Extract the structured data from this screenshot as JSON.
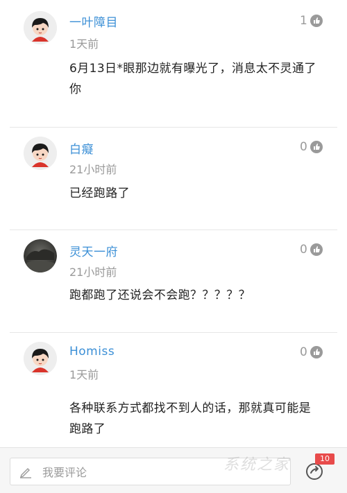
{
  "comments": [
    {
      "username": "一叶障目",
      "time": "1天前",
      "likes": "1",
      "content": "6月13日*眼那边就有曝光了，消息太不灵通了你",
      "avatar": "cartoon-girl-avatar"
    },
    {
      "username": "白癡",
      "time": "21小时前",
      "likes": "0",
      "content": "已经跑路了",
      "avatar": "cartoon-girl-avatar"
    },
    {
      "username": "灵天一府",
      "time": "21小时前",
      "likes": "0",
      "content": "跑都跑了还说会不会跑？？？？？",
      "avatar": "dark-scenery-avatar"
    },
    {
      "username": "Homiss",
      "time": "1天前",
      "likes": "0",
      "content": "各种联系方式都找不到人的话，那就真可能是跑路了",
      "avatar": "cartoon-girl-avatar"
    }
  ],
  "bottom_bar": {
    "comment_placeholder": "我要评论",
    "badge_count": "10"
  },
  "watermark": "系统之家",
  "colors": {
    "username": "#3b8fd6",
    "meta": "#9a9a9a",
    "badge": "#e84b4b"
  }
}
